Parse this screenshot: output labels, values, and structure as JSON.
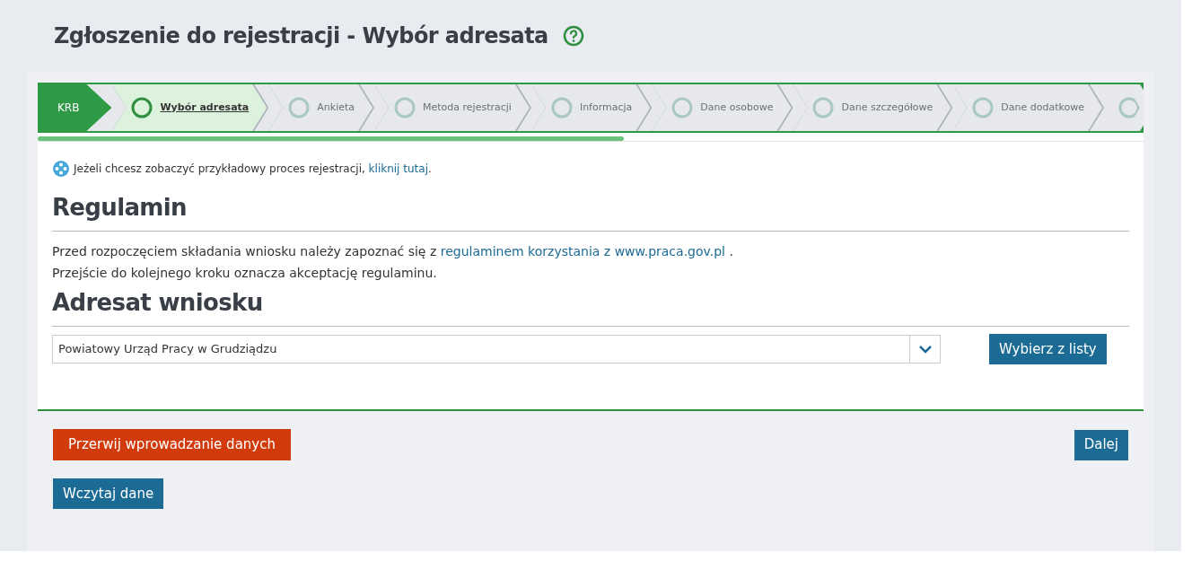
{
  "page": {
    "title": "Zgłoszenie do rejestracji - Wybór adresata"
  },
  "stepper": {
    "start": "KRB",
    "steps": [
      {
        "label": "Wybór adresata",
        "selected": true
      },
      {
        "label": "Ankieta",
        "selected": false
      },
      {
        "label": "Metoda rejestracji",
        "selected": false
      },
      {
        "label": "Informacja",
        "selected": false
      },
      {
        "label": "Dane osobowe",
        "selected": false
      },
      {
        "label": "Dane szczegółowe",
        "selected": false
      },
      {
        "label": "Dane dodatkowe",
        "selected": false
      }
    ],
    "progress": {
      "level": 0.53
    }
  },
  "info": {
    "text": "Jeżeli chcesz zobaczyć przykładowy proces rejestracji,",
    "link": "kliknij tutaj",
    "after": "."
  },
  "regulamin": {
    "heading": "Regulamin",
    "line1": "Przed rozpoczęciem składania wniosku należy zapoznać się z",
    "link": "regulaminem korzystania z www.praca.gov.pl",
    "after": ".",
    "line2": "Przejście do kolejnego kroku oznacza akceptację regulaminu."
  },
  "adresat": {
    "heading": "Adresat wniosku",
    "value": "Powiatowy Urząd Pracy w Grudziądzu",
    "choose_button": "Wybierz z listy"
  },
  "buttons": {
    "abort": "Przerwij wprowadzanie danych",
    "next": "Dalej",
    "load": "Wczytaj dane"
  }
}
